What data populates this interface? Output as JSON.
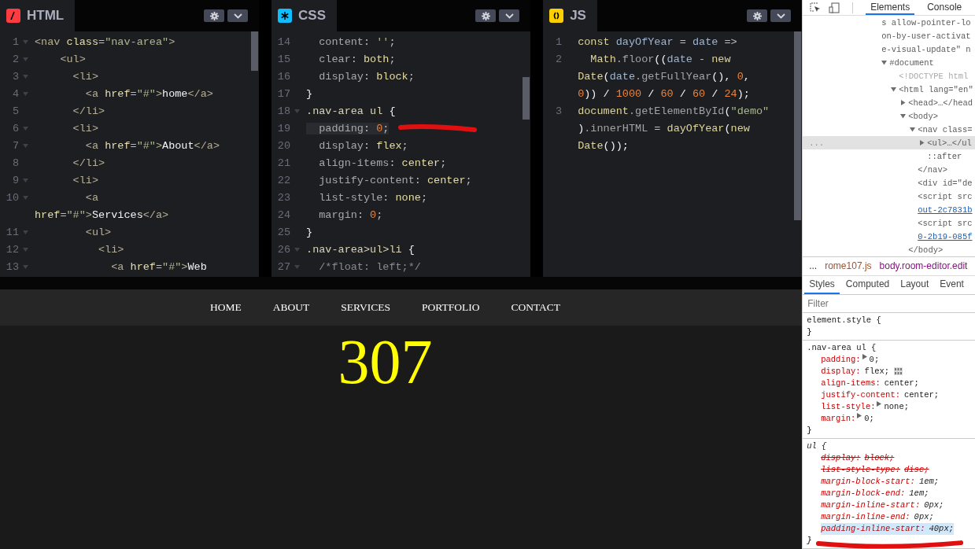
{
  "editors": [
    {
      "kind": "html",
      "title": "HTML",
      "lines": [
        {
          "number": "1",
          "fold": true,
          "active": false,
          "tokens": [
            {
              "text": "<nav ",
              "kind": "tag"
            },
            {
              "text": "class",
              "kind": "attr"
            },
            {
              "text": "=",
              "kind": "punct"
            },
            {
              "text": "\"nav-area\"",
              "kind": "str"
            },
            {
              "text": ">",
              "kind": "tag"
            }
          ]
        },
        {
          "number": "2",
          "fold": true,
          "active": false,
          "tokens": [
            {
              "text": "    <ul>",
              "kind": "tag"
            }
          ]
        },
        {
          "number": "3",
          "fold": true,
          "active": false,
          "tokens": [
            {
              "text": "      <li>",
              "kind": "tag"
            }
          ]
        },
        {
          "number": "4",
          "fold": true,
          "active": false,
          "tokens": [
            {
              "text": "        <a ",
              "kind": "tag"
            },
            {
              "text": "href",
              "kind": "attr"
            },
            {
              "text": "=",
              "kind": "punct"
            },
            {
              "text": "\"#\"",
              "kind": "str"
            },
            {
              "text": ">",
              "kind": "tag"
            },
            {
              "text": "home",
              "kind": "text"
            },
            {
              "text": "</a>",
              "kind": "tag"
            }
          ]
        },
        {
          "number": "5",
          "fold": false,
          "active": false,
          "tokens": [
            {
              "text": "      </li>",
              "kind": "tag"
            }
          ]
        },
        {
          "number": "6",
          "fold": true,
          "active": false,
          "tokens": [
            {
              "text": "      <li>",
              "kind": "tag"
            }
          ]
        },
        {
          "number": "7",
          "fold": true,
          "active": false,
          "tokens": [
            {
              "text": "        <a ",
              "kind": "tag"
            },
            {
              "text": "href",
              "kind": "attr"
            },
            {
              "text": "=",
              "kind": "punct"
            },
            {
              "text": "\"#\"",
              "kind": "str"
            },
            {
              "text": ">",
              "kind": "tag"
            },
            {
              "text": "About",
              "kind": "text"
            },
            {
              "text": "</a>",
              "kind": "tag"
            }
          ]
        },
        {
          "number": "8",
          "fold": false,
          "active": false,
          "tokens": [
            {
              "text": "      </li>",
              "kind": "tag"
            }
          ]
        },
        {
          "number": "9",
          "fold": true,
          "active": false,
          "tokens": [
            {
              "text": "      <li>",
              "kind": "tag"
            }
          ]
        },
        {
          "number": "10",
          "fold": true,
          "active": false,
          "tokens": [
            {
              "text": "        <a",
              "kind": "tag"
            }
          ]
        },
        {
          "active": false,
          "tokens": [
            {
              "text": "href",
              "kind": "attr"
            },
            {
              "text": "=",
              "kind": "punct"
            },
            {
              "text": "\"#\"",
              "kind": "str"
            },
            {
              "text": ">",
              "kind": "tag"
            },
            {
              "text": "Services",
              "kind": "text"
            },
            {
              "text": "</a>",
              "kind": "tag"
            }
          ]
        },
        {
          "number": "11",
          "fold": true,
          "active": false,
          "tokens": [
            {
              "text": "        <ul>",
              "kind": "tag"
            }
          ]
        },
        {
          "number": "12",
          "fold": true,
          "active": false,
          "tokens": [
            {
              "text": "          <li>",
              "kind": "tag"
            }
          ]
        },
        {
          "number": "13",
          "fold": true,
          "active": false,
          "tokens": [
            {
              "text": "            <a ",
              "kind": "tag"
            },
            {
              "text": "href",
              "kind": "attr"
            },
            {
              "text": "=",
              "kind": "punct"
            },
            {
              "text": "\"#\"",
              "kind": "str"
            },
            {
              "text": ">",
              "kind": "tag"
            },
            {
              "text": "Web",
              "kind": "text"
            }
          ]
        }
      ]
    },
    {
      "kind": "css",
      "title": "CSS",
      "lines": [
        {
          "number": "14",
          "fold": false,
          "active": false,
          "tokens": [
            {
              "text": "  content",
              "kind": "prop"
            },
            {
              "text": ": ",
              "kind": "punct"
            },
            {
              "text": "''",
              "kind": "str"
            },
            {
              "text": ";",
              "kind": "punct"
            }
          ]
        },
        {
          "number": "15",
          "fold": false,
          "active": false,
          "tokens": [
            {
              "text": "  clear",
              "kind": "prop"
            },
            {
              "text": ": ",
              "kind": "punct"
            },
            {
              "text": "both",
              "kind": "val"
            },
            {
              "text": ";",
              "kind": "punct"
            }
          ]
        },
        {
          "number": "16",
          "fold": false,
          "active": false,
          "tokens": [
            {
              "text": "  display",
              "kind": "prop"
            },
            {
              "text": ": ",
              "kind": "punct"
            },
            {
              "text": "block",
              "kind": "val"
            },
            {
              "text": ";",
              "kind": "punct"
            }
          ]
        },
        {
          "number": "17",
          "fold": false,
          "active": false,
          "tokens": [
            {
              "text": "}",
              "kind": "text"
            }
          ]
        },
        {
          "number": "18",
          "fold": true,
          "active": false,
          "tokens": [
            {
              "text": ".nav-area ul ",
              "kind": "sel"
            },
            {
              "text": "{",
              "kind": "text"
            }
          ]
        },
        {
          "number": "19",
          "fold": false,
          "active": true,
          "marked": true,
          "tokens": [
            {
              "text": "  padding",
              "kind": "prop"
            },
            {
              "text": ": ",
              "kind": "punct"
            },
            {
              "text": "0",
              "kind": "num"
            },
            {
              "text": ";",
              "kind": "punct"
            }
          ]
        },
        {
          "number": "20",
          "fold": false,
          "active": false,
          "tokens": [
            {
              "text": "  display",
              "kind": "prop"
            },
            {
              "text": ": ",
              "kind": "punct"
            },
            {
              "text": "flex",
              "kind": "val"
            },
            {
              "text": ";",
              "kind": "punct"
            }
          ]
        },
        {
          "number": "21",
          "fold": false,
          "active": false,
          "tokens": [
            {
              "text": "  align-items",
              "kind": "prop"
            },
            {
              "text": ": ",
              "kind": "punct"
            },
            {
              "text": "center",
              "kind": "val"
            },
            {
              "text": ";",
              "kind": "punct"
            }
          ]
        },
        {
          "number": "22",
          "fold": false,
          "active": false,
          "tokens": [
            {
              "text": "  justify-content",
              "kind": "prop"
            },
            {
              "text": ": ",
              "kind": "punct"
            },
            {
              "text": "center",
              "kind": "val"
            },
            {
              "text": ";",
              "kind": "punct"
            }
          ]
        },
        {
          "number": "23",
          "fold": false,
          "active": false,
          "tokens": [
            {
              "text": "  list-style",
              "kind": "prop"
            },
            {
              "text": ": ",
              "kind": "punct"
            },
            {
              "text": "none",
              "kind": "val"
            },
            {
              "text": ";",
              "kind": "punct"
            }
          ]
        },
        {
          "number": "24",
          "fold": false,
          "active": false,
          "tokens": [
            {
              "text": "  margin",
              "kind": "prop"
            },
            {
              "text": ": ",
              "kind": "punct"
            },
            {
              "text": "0",
              "kind": "num"
            },
            {
              "text": ";",
              "kind": "punct"
            }
          ]
        },
        {
          "number": "25",
          "fold": false,
          "active": false,
          "tokens": [
            {
              "text": "}",
              "kind": "text"
            }
          ]
        },
        {
          "number": "26",
          "fold": true,
          "active": false,
          "tokens": [
            {
              "text": ".nav-area>ul>li ",
              "kind": "sel"
            },
            {
              "text": "{",
              "kind": "text"
            }
          ]
        },
        {
          "number": "27",
          "fold": true,
          "active": false,
          "tokens": [
            {
              "text": "  /*float: left;*/",
              "kind": "comment"
            }
          ]
        }
      ]
    },
    {
      "kind": "js",
      "title": "JS",
      "lines": [
        {
          "number": "1",
          "fold": false,
          "active": false,
          "tokens": [
            {
              "text": "const ",
              "kind": "kw"
            },
            {
              "text": "dayOfYear",
              "kind": "var"
            },
            {
              "text": " = ",
              "kind": "punct"
            },
            {
              "text": "date",
              "kind": "var"
            },
            {
              "text": " =>",
              "kind": "punct"
            }
          ]
        },
        {
          "number": "2",
          "fold": false,
          "active": false,
          "tokens": [
            {
              "text": "  Math",
              "kind": "kw"
            },
            {
              "text": ".floor",
              "kind": "fn"
            },
            {
              "text": "((",
              "kind": "text"
            },
            {
              "text": "date",
              "kind": "var"
            },
            {
              "text": " - ",
              "kind": "punct"
            },
            {
              "text": "new",
              "kind": "kw"
            }
          ]
        },
        {
          "active": false,
          "tokens": [
            {
              "text": "Date",
              "kind": "kw"
            },
            {
              "text": "(",
              "kind": "text"
            },
            {
              "text": "date",
              "kind": "var"
            },
            {
              "text": ".getFullYear",
              "kind": "fn"
            },
            {
              "text": "(), ",
              "kind": "text"
            },
            {
              "text": "0",
              "kind": "num"
            },
            {
              "text": ",",
              "kind": "text"
            }
          ]
        },
        {
          "active": false,
          "tokens": [
            {
              "text": "0",
              "kind": "num"
            },
            {
              "text": ")) / ",
              "kind": "text"
            },
            {
              "text": "1000",
              "kind": "num"
            },
            {
              "text": " / ",
              "kind": "text"
            },
            {
              "text": "60",
              "kind": "num"
            },
            {
              "text": " / ",
              "kind": "text"
            },
            {
              "text": "60",
              "kind": "num"
            },
            {
              "text": " / ",
              "kind": "text"
            },
            {
              "text": "24",
              "kind": "num"
            },
            {
              "text": ");",
              "kind": "text"
            }
          ]
        },
        {
          "number": "3",
          "fold": false,
          "active": false,
          "tokens": [
            {
              "text": "document",
              "kind": "kw"
            },
            {
              "text": ".getElementById",
              "kind": "fn"
            },
            {
              "text": "(",
              "kind": "text"
            },
            {
              "text": "\"demo\"",
              "kind": "str"
            }
          ]
        },
        {
          "active": false,
          "tokens": [
            {
              "text": ")",
              "kind": "text"
            },
            {
              "text": ".innerHTML",
              "kind": "fn"
            },
            {
              "text": " = ",
              "kind": "punct"
            },
            {
              "text": "dayOfYear",
              "kind": "kw"
            },
            {
              "text": "(",
              "kind": "text"
            },
            {
              "text": "new",
              "kind": "kw"
            }
          ]
        },
        {
          "active": false,
          "tokens": [
            {
              "text": "Date",
              "kind": "kw"
            },
            {
              "text": "());",
              "kind": "text"
            }
          ]
        }
      ]
    }
  ],
  "preview": {
    "nav": [
      {
        "label": "HOME"
      },
      {
        "label": "ABOUT"
      },
      {
        "label": "SERVICES"
      },
      {
        "label": "PORTFOLIO"
      },
      {
        "label": "CONTACT"
      }
    ],
    "output": "307"
  },
  "devtools": {
    "tabs": [
      {
        "label": "Elements",
        "selected": true
      },
      {
        "label": "Console",
        "selected": false
      }
    ],
    "dom": [
      {
        "kind": "wrap",
        "text": "s allow-pointer-lo"
      },
      {
        "kind": "wrap",
        "text": "on-by-user-activat"
      },
      {
        "kind": "wrap",
        "text": "e-visual-update\" n"
      },
      {
        "kind": "tag",
        "text": "#document",
        "expanded": true,
        "selected": false,
        "children": [
          {
            "kind": "doctype",
            "text": "<!DOCTYPE html",
            "selected": false
          },
          {
            "kind": "tag",
            "text": "<html lang=\"en\"",
            "expanded": true,
            "selected": false,
            "children": [
              {
                "kind": "tag",
                "text": "<head>…</head",
                "expanded": false,
                "selected": false
              },
              {
                "kind": "tag",
                "text": "<body>",
                "expanded": true,
                "selected": false,
                "children": [
                  {
                    "kind": "tag",
                    "text": "<nav class=",
                    "expanded": true,
                    "selected": false,
                    "children": [
                      {
                        "kind": "tag",
                        "text": "<ul>…</ul",
                        "expanded": false,
                        "selected": true,
                        "menu": "..."
                      },
                      {
                        "kind": "pseudo",
                        "text": "::after",
                        "selected": false
                      }
                    ]
                  },
                  {
                    "kind": "tag",
                    "text": "</nav>",
                    "selected": false
                  },
                  {
                    "kind": "tag",
                    "text": "<div id=\"de",
                    "selected": false
                  },
                  {
                    "kind": "tag",
                    "text": "<script src",
                    "selected": false
                  },
                  {
                    "kind": "link",
                    "text": "out-2c7831b",
                    "selected": false
                  },
                  {
                    "kind": "tag",
                    "text": "<script src",
                    "selected": false
                  },
                  {
                    "kind": "link",
                    "text": "0-2b19-085f",
                    "selected": false
                  }
                ]
              },
              {
                "kind": "tag",
                "text": "</body>",
                "selected": false
              }
            ]
          }
        ]
      }
    ],
    "sources": [
      {
        "kind": "more",
        "label": "..."
      },
      {
        "kind": "file",
        "label": "rome107.js"
      },
      {
        "kind": "selector",
        "label": "body.room-editor.edit"
      }
    ],
    "style_tabs": [
      {
        "label": "Styles",
        "selected": true
      },
      {
        "label": "Computed",
        "selected": false
      },
      {
        "label": "Layout",
        "selected": false
      },
      {
        "label": "Event",
        "selected": false
      }
    ],
    "filter": {
      "placeholder": "Filter"
    },
    "rules": [
      {
        "kind": "author",
        "selector": "element.style {",
        "close": "}"
      },
      {
        "kind": "author",
        "selector": ".nav-area ul {",
        "close": "}",
        "props": [
          {
            "name": "padding:",
            "value": "0;",
            "expandable": true,
            "struck": false,
            "selected": false
          },
          {
            "name": "display:",
            "value": "flex;",
            "expandable": false,
            "struck": false,
            "selected": false,
            "flex_editor": true
          },
          {
            "name": "align-items:",
            "value": "center;",
            "expandable": false,
            "struck": false,
            "selected": false
          },
          {
            "name": "justify-content:",
            "value": "center;",
            "expandable": false,
            "struck": false,
            "selected": false
          },
          {
            "name": "list-style:",
            "value": "none;",
            "expandable": true,
            "struck": false,
            "selected": false
          },
          {
            "name": "margin:",
            "value": "0;",
            "expandable": true,
            "struck": false,
            "selected": false
          }
        ]
      },
      {
        "kind": "user-agent",
        "selector": "ul {",
        "close": "}",
        "props": [
          {
            "name": "display:",
            "value": "block;",
            "expandable": false,
            "struck": true,
            "selected": false
          },
          {
            "name": "list-style-type:",
            "value": "disc;",
            "expandable": false,
            "struck": true,
            "selected": false
          },
          {
            "name": "margin-block-start:",
            "value": "1em;",
            "expandable": false,
            "struck": false,
            "selected": false
          },
          {
            "name": "margin-block-end:",
            "value": "1em;",
            "expandable": false,
            "struck": false,
            "selected": false
          },
          {
            "name": "margin-inline-start:",
            "value": "0px;",
            "expandable": false,
            "struck": false,
            "selected": false
          },
          {
            "name": "margin-inline-end:",
            "value": "0px;",
            "expandable": false,
            "struck": false,
            "selected": false
          },
          {
            "name": "padding-inline-start:",
            "value": "40px;",
            "expandable": false,
            "struck": false,
            "selected": true,
            "marked": true
          }
        ]
      }
    ]
  }
}
